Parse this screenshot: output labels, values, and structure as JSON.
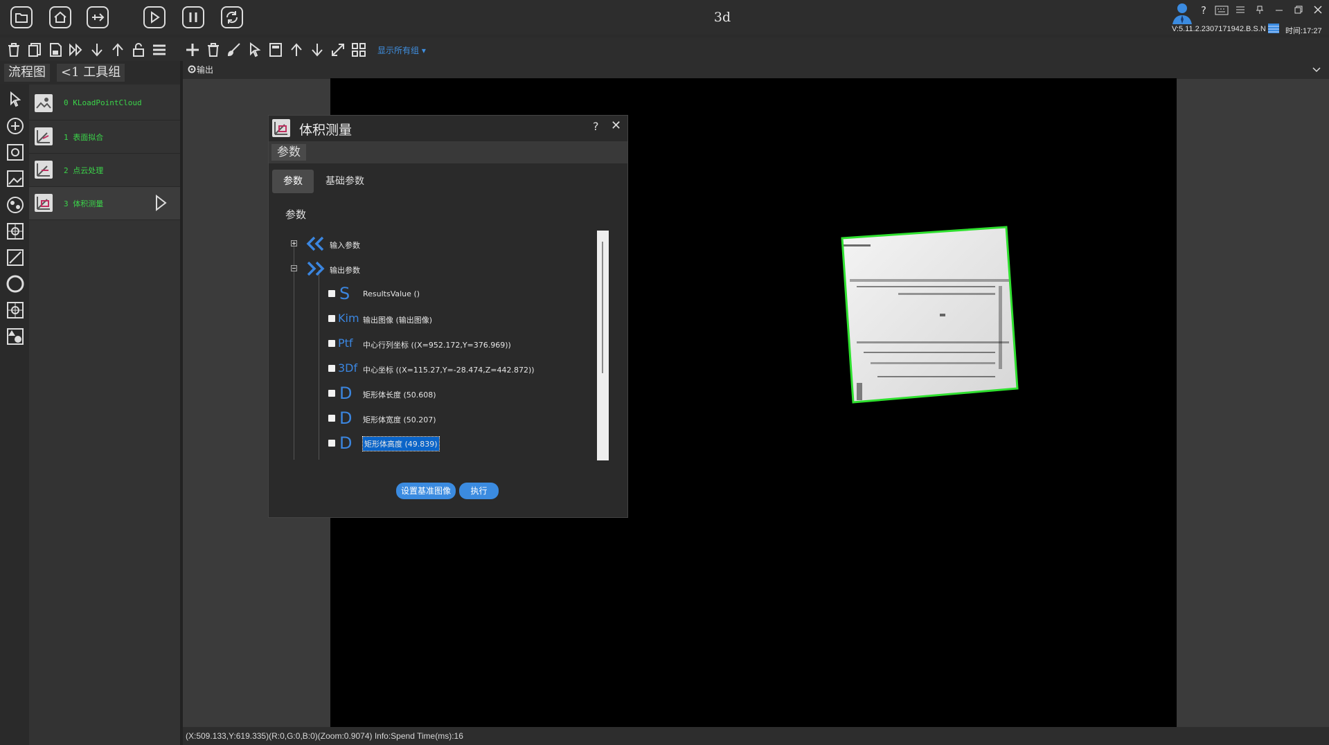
{
  "window": {
    "title": "3d",
    "version": "V:5.11.2.2307171942.B.S.N",
    "time": "时间:17:27"
  },
  "toolbar": {
    "show_all_label": "显示所有组"
  },
  "left_tabs": {
    "flow": "流程图",
    "group": "<1 工具组"
  },
  "flow_nodes": [
    {
      "label": "0 KLoadPointCloud"
    },
    {
      "label": "1 表面拟合"
    },
    {
      "label": "2 点云处理"
    },
    {
      "label": "3 体积测量"
    }
  ],
  "viewer": {
    "output_label": "输出",
    "status": "(X:509.133,Y:619.335)(R:0,G:0,B:0)(Zoom:0.9074)   Info:Spend Time(ms):16"
  },
  "dialog": {
    "title": "体积测量",
    "help": "?",
    "close": "✕",
    "section": "参数",
    "tabs": {
      "params": "参数",
      "basic": "基础参数"
    },
    "heading": "参数",
    "input_group": "输入参数",
    "output_group": "输出参数",
    "outputs": [
      {
        "prefix": "S",
        "label": "ResultsValue",
        "value": "()"
      },
      {
        "prefix": "Kim",
        "label": "输出图像",
        "value": "(输出图像)"
      },
      {
        "prefix": "Ptf",
        "label": "中心行列坐标",
        "value": "((X=952.172,Y=376.969))"
      },
      {
        "prefix": "3Df",
        "label": "中心坐标",
        "value": "((X=115.27,Y=-28.474,Z=442.872))"
      },
      {
        "prefix": "D",
        "label": "矩形体长度",
        "value": "(50.608)"
      },
      {
        "prefix": "D",
        "label": "矩形体宽度",
        "value": "(50.207)"
      },
      {
        "prefix": "D",
        "label": "矩形体高度",
        "value": "(49.839)"
      }
    ],
    "buttons": {
      "set_base": "设置基准图像",
      "execute": "执行"
    }
  },
  "colors": {
    "accent": "#3b8be0",
    "node_text": "#3bd44a",
    "detect_box": "#2fe02f"
  }
}
